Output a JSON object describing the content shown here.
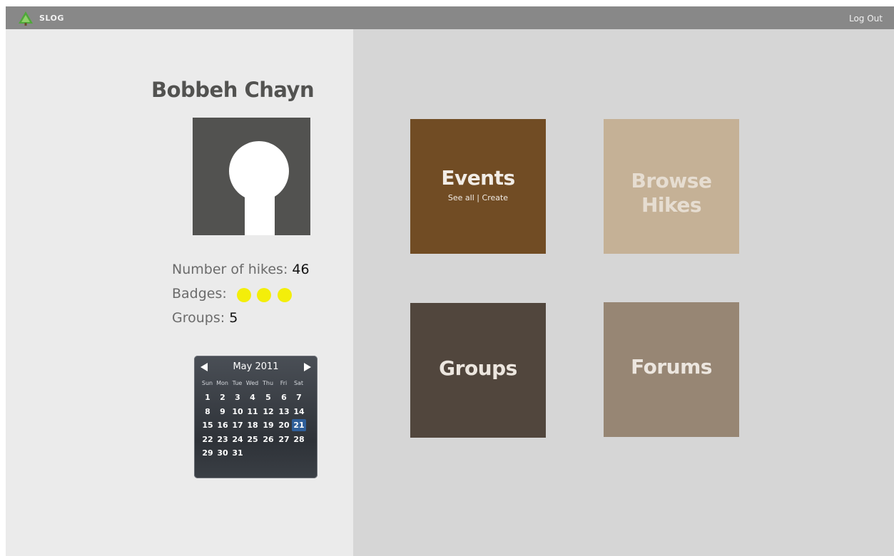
{
  "header": {
    "brand": "SLOG",
    "logout_label": "Log Out",
    "logo_icon": "tree-icon",
    "logo_color": "#4fa83a"
  },
  "profile": {
    "name": "Bobbeh Chayn",
    "hikes_label": "Number of hikes:",
    "hikes_value": "46",
    "badges_label": "Badges:",
    "badge_count": 3,
    "badge_color": "#f3ee0a",
    "groups_label": "Groups:",
    "groups_value": "5"
  },
  "calendar": {
    "title": "May 2011",
    "weekdays": [
      "Sun",
      "Mon",
      "Tue",
      "Wed",
      "Thu",
      "Fri",
      "Sat"
    ],
    "weeks": [
      [
        "1",
        "2",
        "3",
        "4",
        "5",
        "6",
        "7"
      ],
      [
        "8",
        "9",
        "10",
        "11",
        "12",
        "13",
        "14"
      ],
      [
        "15",
        "16",
        "17",
        "18",
        "19",
        "20",
        "21"
      ],
      [
        "22",
        "23",
        "24",
        "25",
        "26",
        "27",
        "28"
      ],
      [
        "29",
        "30",
        "31"
      ]
    ],
    "selected_day": "21"
  },
  "tiles": {
    "events": {
      "title": "Events",
      "see_all": "See all",
      "separator": "|",
      "create": "Create",
      "color": "#714c24"
    },
    "browse": {
      "title_line1": "Browse",
      "title_line2": "Hikes",
      "color": "#c5b196"
    },
    "groups": {
      "title": "Groups",
      "color": "#51463d"
    },
    "forums": {
      "title": "Forums",
      "color": "#978674"
    }
  }
}
